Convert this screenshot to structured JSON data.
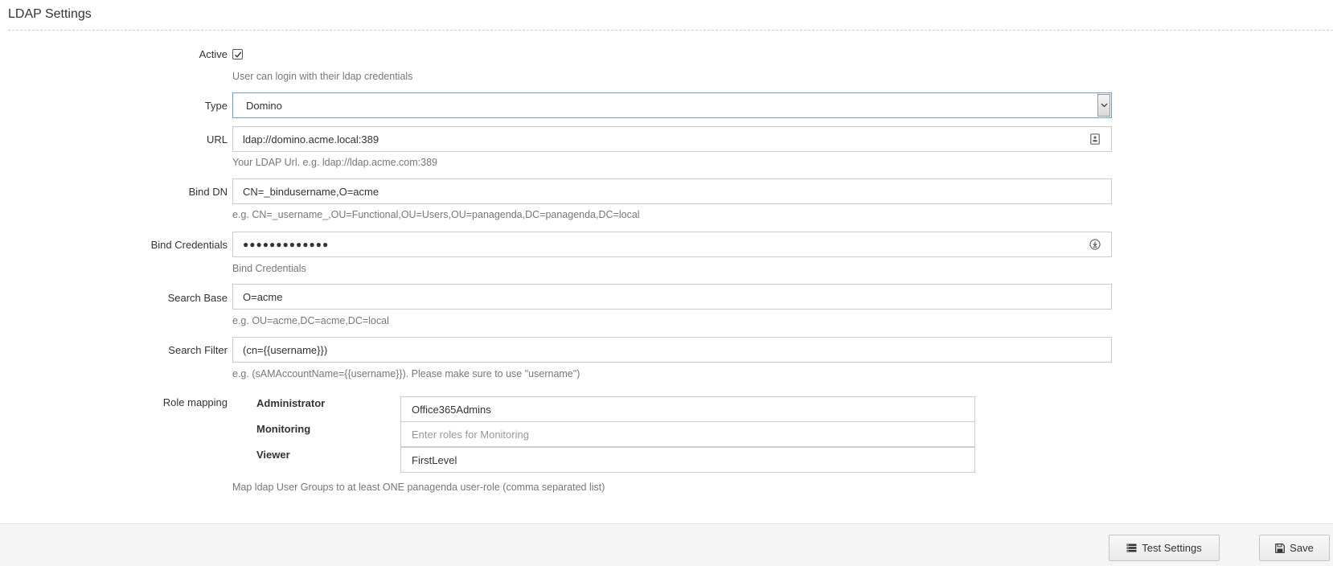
{
  "header": {
    "title": "LDAP Settings"
  },
  "form": {
    "active": {
      "label": "Active",
      "checked": true,
      "help": "User can login with their ldap credentials"
    },
    "type": {
      "label": "Type",
      "value": "Domino"
    },
    "url": {
      "label": "URL",
      "value": "ldap://domino.acme.local:389",
      "help": "Your LDAP Url. e.g. ldap://ldap.acme.com:389"
    },
    "bind_dn": {
      "label": "Bind DN",
      "value": "CN=_bindusername,O=acme",
      "help": "e.g. CN=_username_,OU=Functional,OU=Users,OU=panagenda,DC=panagenda,DC=local"
    },
    "bind_credentials": {
      "label": "Bind Credentials",
      "value": "●●●●●●●●●●●●●",
      "help": "Bind Credentials"
    },
    "search_base": {
      "label": "Search Base",
      "value": "O=acme",
      "help": "e.g. OU=acme,DC=acme,DC=local"
    },
    "search_filter": {
      "label": "Search Filter",
      "value": "(cn={{username}})",
      "help": "e.g. (sAMAccountName={{username}}). Please make sure to use \"username\")"
    },
    "role_mapping": {
      "label": "Role mapping",
      "roles": [
        {
          "name": "Administrator",
          "value": "Office365Admins",
          "placeholder": ""
        },
        {
          "name": "Monitoring",
          "value": "",
          "placeholder": "Enter roles for Monitoring"
        },
        {
          "name": "Viewer",
          "value": "FirstLevel",
          "placeholder": ""
        }
      ],
      "help": "Map ldap User Groups to at least ONE panagenda user-role (comma separated list)"
    }
  },
  "footer": {
    "test_label": "Test Settings",
    "save_label": "Save"
  },
  "icons": {
    "checkbox": "check-icon",
    "select": "chevron-down-icon",
    "url_field": "contact-card-icon",
    "password_field": "reveal-password-icon",
    "test_button": "server-icon",
    "save_button": "floppy-disk-icon"
  }
}
